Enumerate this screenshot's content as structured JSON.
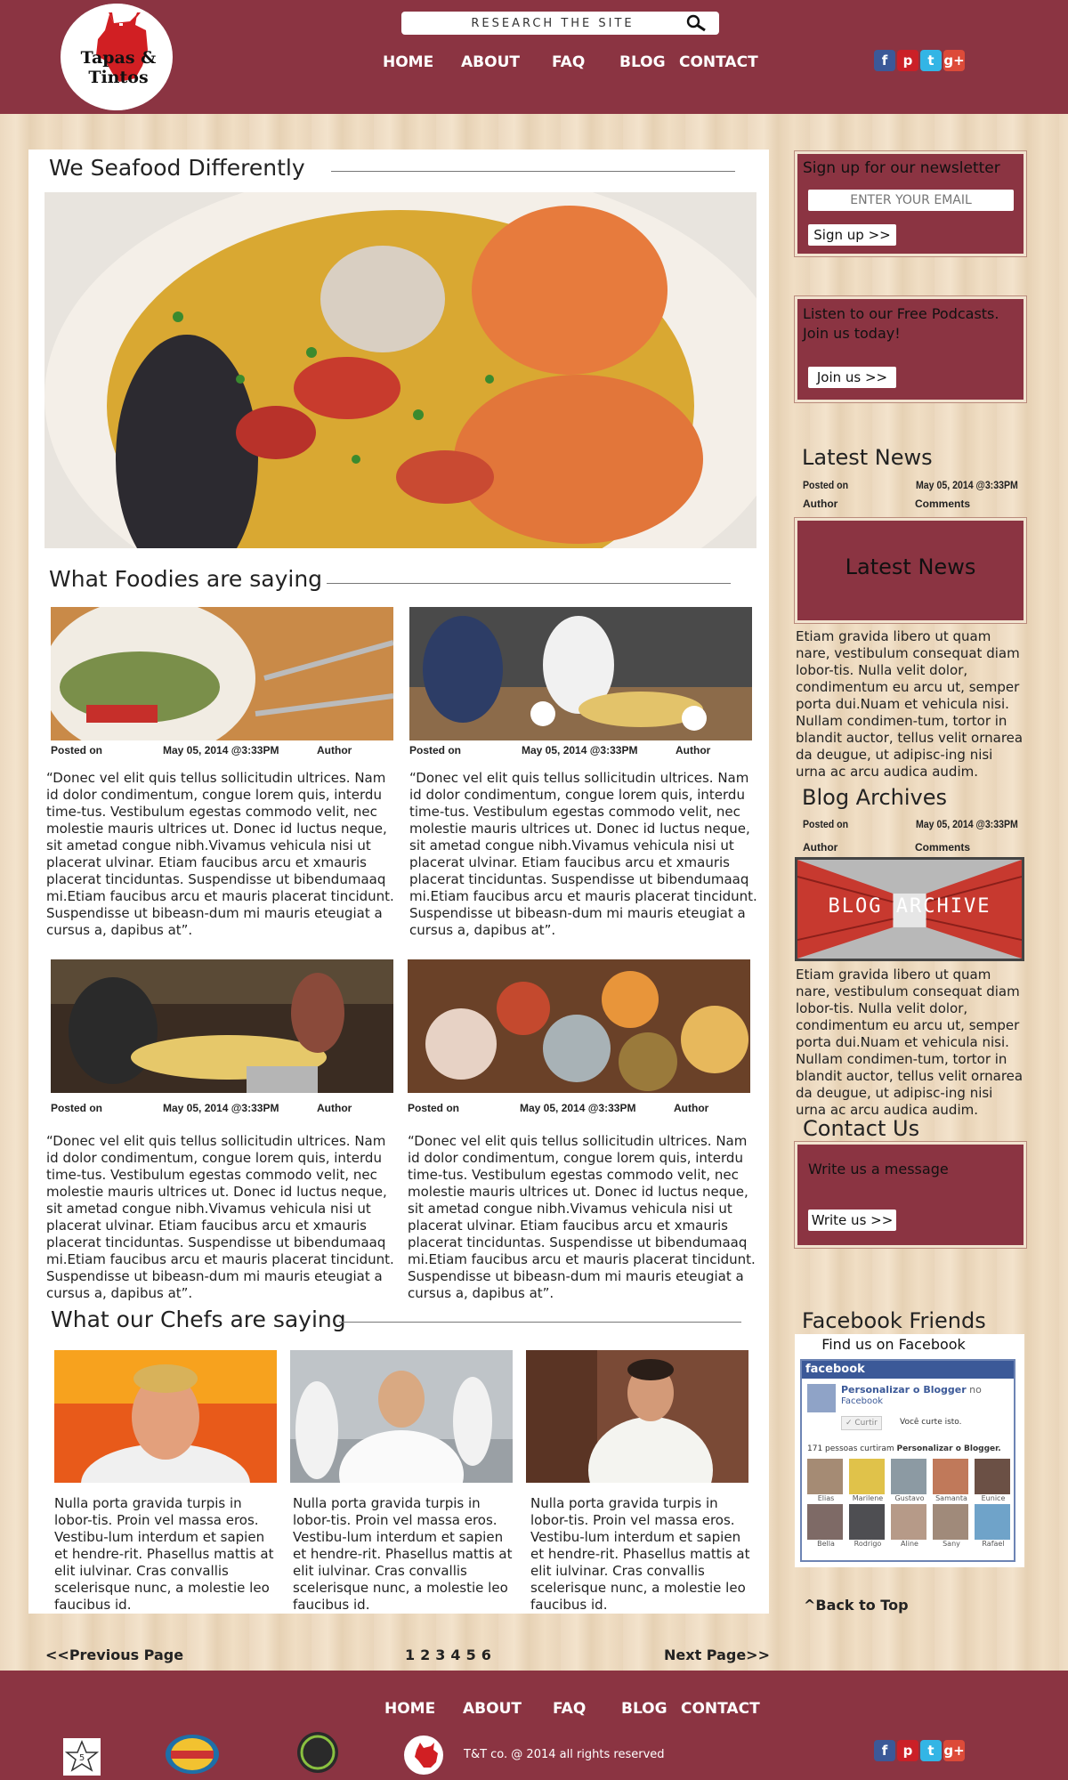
{
  "brand": {
    "logo_text": "Tapas & Tintos"
  },
  "search": {
    "placeholder": "RESEARCH THE SITE"
  },
  "nav": {
    "items": [
      "HOME",
      "ABOUT",
      "FAQ",
      "BLOG",
      "CONTACT"
    ]
  },
  "social": {
    "icons": [
      "facebook-icon",
      "pinterest-icon",
      "twitter-icon",
      "google-plus-icon"
    ]
  },
  "main": {
    "hero_title": "We Seafood Differently",
    "foodies_title": "What Foodies are saying",
    "chefs_title": "What our Chefs are saying",
    "posts": [
      {
        "posted": "Posted on",
        "date": "May 05, 2014 @3:33PM",
        "author": "Author",
        "quote": "“Donec vel elit quis tellus sollicitudin ultrices. Nam id dolor condimentum, congue lorem quis, interdu time-tus. Vestibulum egestas commodo velit, nec molestie mauris ultrices ut. Donec id luctus neque, sit ametad congue nibh.Vivamus vehicula nisi ut placerat ulvinar. Etiam faucibus arcu et xmauris placerat tinciduntas. Suspendisse ut bibendumaaq mi.Etiam faucibus arcu et mauris placerat tincidunt. Suspendisse ut bibeasn-dum mi mauris eteugiat a cursus a, dapibus at”."
      },
      {
        "posted": "Posted on",
        "date": "May 05, 2014 @3:33PM",
        "author": "Author",
        "quote": "“Donec vel elit quis tellus sollicitudin ultrices. Nam id dolor condimentum, congue lorem quis, interdu time-tus. Vestibulum egestas commodo velit, nec molestie mauris ultrices ut. Donec id luctus neque, sit ametad congue nibh.Vivamus vehicula nisi ut placerat ulvinar. Etiam faucibus arcu et xmauris placerat tinciduntas. Suspendisse ut bibendumaaq mi.Etiam faucibus arcu et mauris placerat tincidunt. Suspendisse ut bibeasn-dum mi mauris eteugiat a cursus a, dapibus at”."
      },
      {
        "posted": "Posted on",
        "date": "May 05, 2014 @3:33PM",
        "author": "Author",
        "quote": "“Donec vel elit quis tellus sollicitudin ultrices. Nam id dolor condimentum, congue lorem quis, interdu time-tus. Vestibulum egestas commodo velit, nec molestie mauris ultrices ut. Donec id luctus neque, sit ametad congue nibh.Vivamus vehicula nisi ut placerat ulvinar. Etiam faucibus arcu et xmauris placerat tinciduntas. Suspendisse ut bibendumaaq mi.Etiam faucibus arcu et mauris placerat tincidunt. Suspendisse ut bibeasn-dum mi mauris eteugiat a cursus a, dapibus at”."
      },
      {
        "posted": "Posted on",
        "date": "May 05, 2014 @3:33PM",
        "author": "Author",
        "quote": "“Donec vel elit quis tellus sollicitudin ultrices. Nam id dolor condimentum, congue lorem quis, interdu time-tus. Vestibulum egestas commodo velit, nec molestie mauris ultrices ut. Donec id luctus neque, sit ametad congue nibh.Vivamus vehicula nisi ut placerat ulvinar. Etiam faucibus arcu et xmauris placerat tinciduntas. Suspendisse ut bibendumaaq mi.Etiam faucibus arcu et mauris placerat tincidunt. Suspendisse ut bibeasn-dum mi mauris eteugiat a cursus a, dapibus at”."
      }
    ],
    "chefs": [
      {
        "text": "Nulla porta gravida turpis in lobor-tis. Proin vel massa eros. Vestibu-lum interdum et sapien et hendre-rit. Phasellus mattis at elit iulvinar. Cras convallis scelerisque nunc, a molestie leo faucibus id."
      },
      {
        "text": "Nulla porta gravida turpis in lobor-tis. Proin vel massa eros. Vestibu-lum interdum et sapien et hendre-rit. Phasellus mattis at elit iulvinar. Cras convallis scelerisque nunc, a molestie leo faucibus id."
      },
      {
        "text": "Nulla porta gravida turpis in lobor-tis. Proin vel massa eros. Vestibu-lum interdum et sapien et hendre-rit. Phasellus mattis at elit iulvinar. Cras convallis scelerisque nunc, a molestie leo faucibus id."
      }
    ]
  },
  "sidebar": {
    "newsletter": {
      "title": "Sign up for our newsletter",
      "email_placeholder": "ENTER YOUR EMAIL",
      "button": "Sign up >>"
    },
    "podcasts": {
      "text": "Listen to our Free Podcasts. Join us today!",
      "button": "Join us >>"
    },
    "latest_news": {
      "title": "Latest News",
      "posted": "Posted on",
      "date": "May 05, 2014 @3:33PM",
      "author": "Author",
      "comments": "Comments",
      "banner": "Latest News",
      "text": "Etiam gravida libero ut quam nare, vestibulum consequat diam lobor-tis. Nulla velit dolor, condimentum eu arcu ut, semper porta dui.Nuam et vehicula nisi. Nullam condimen-tum, tortor in blandit auctor, tellus velit ornarea da deugue, ut adipisc-ing nisi urna ac arcu audica audim."
    },
    "blog_archives": {
      "title": "Blog Archives",
      "posted": "Posted on",
      "date": "May 05, 2014 @3:33PM",
      "author": "Author",
      "comments": "Comments",
      "banner": "BLOG ARCHIVE",
      "text": "Etiam gravida libero ut quam nare, vestibulum consequat diam lobor-tis. Nulla velit dolor, condimentum eu arcu ut, semper porta dui.Nuam et vehicula nisi. Nullam condimen-tum, tortor in blandit auctor, tellus velit ornarea da deugue, ut adipisc-ing nisi urna ac arcu audica audim."
    },
    "contact": {
      "title": "Contact Us",
      "prompt": "Write us a message",
      "button": "Write us >>"
    },
    "facebook": {
      "title": "Facebook Friends",
      "find_us": "Find us on Facebook",
      "brand": "facebook",
      "page_name": "Personalizar o Blogger",
      "page_suffix": "no",
      "page_sub": "Facebook",
      "like_button": "✓ Curtir",
      "like_note": "Você curte isto.",
      "likes_prefix": "171 pessoas curtiram",
      "likes_page": "Personalizar o Blogger.",
      "friends": [
        "Elias",
        "Marilene",
        "Gustavo",
        "Samanta",
        "Eunice",
        "Bella",
        "Rodrigo",
        "Aline",
        "Sany",
        "Rafael"
      ]
    },
    "back_to_top": "^Back to Top"
  },
  "pager": {
    "prev": "<<Previous Page",
    "pages": [
      "1",
      "2",
      "3",
      "4",
      "5",
      "6"
    ],
    "next": "Next Page>>"
  },
  "footer": {
    "copyright": "T&T co. @ 2014 all rights reserved"
  },
  "colors": {
    "brand": "#8b3442",
    "wood": "#ecd9c0",
    "white": "#ffffff"
  }
}
